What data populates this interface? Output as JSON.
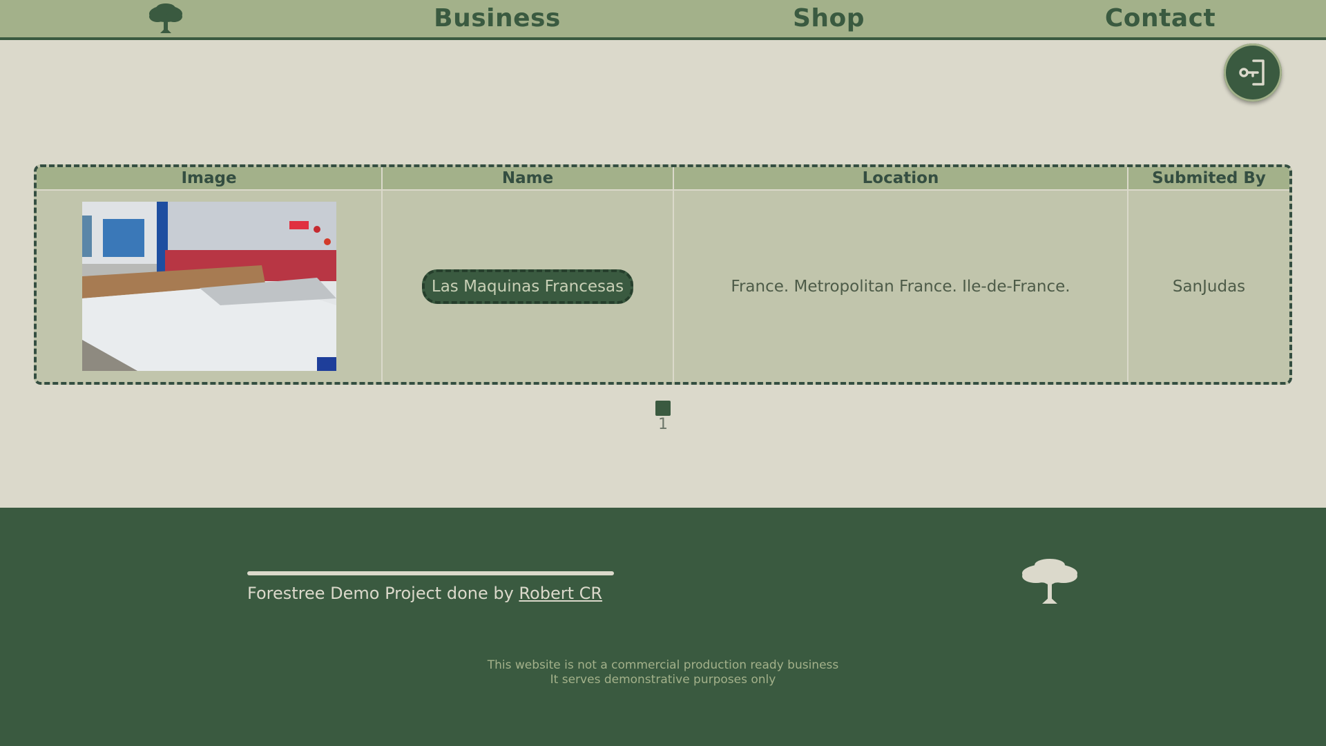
{
  "nav": {
    "logo_icon": "tree-icon",
    "links": [
      "Business",
      "Shop",
      "Contact"
    ]
  },
  "login_button": {
    "icon": "login-key-icon"
  },
  "table": {
    "headers": [
      "Image",
      "Name",
      "Location",
      "Submited By"
    ],
    "rows": [
      {
        "image_alt": "machine-photo",
        "name": "Las Maquinas Francesas",
        "location": "France. Metropolitan France. Ile-de-France.",
        "submitted_by": "SanJudas"
      }
    ]
  },
  "pagination": {
    "pages": [
      "1"
    ]
  },
  "footer": {
    "credit_prefix": "Forestree Demo Project done by ",
    "credit_link": "Robert CR",
    "tree_icon": "tree-icon",
    "note_line1": "This website is not a commercial production ready business",
    "note_line2": "It serves demonstrative purposes only"
  },
  "colors": {
    "nav_bg": "#a3b18a",
    "page_bg": "#dbd9cb",
    "dark_green": "#3a5a40",
    "table_bg": "#c1c5ac"
  }
}
